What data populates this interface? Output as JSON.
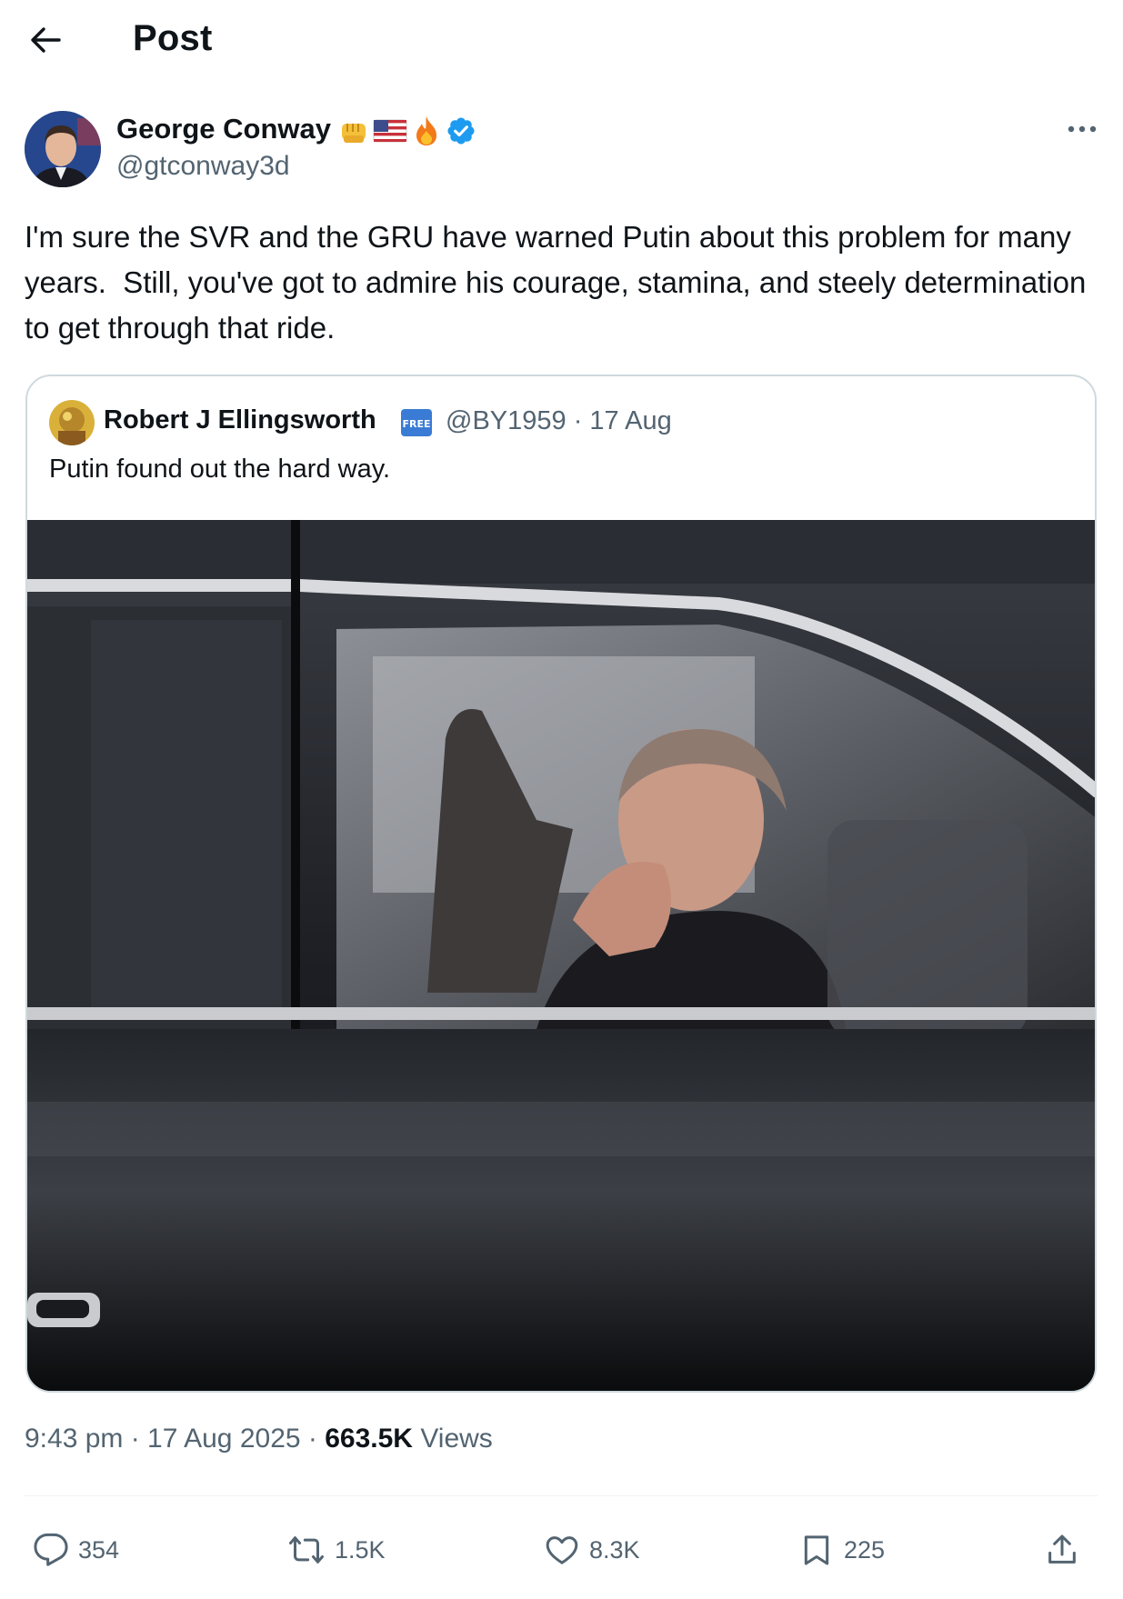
{
  "header": {
    "title": "Post"
  },
  "author": {
    "name": "George Conway",
    "handle": "@gtconway3d",
    "badges": [
      "fist-emoji",
      "us-flag-emoji",
      "fire-emoji",
      "verified-badge"
    ]
  },
  "post": {
    "text": "I'm sure the SVR and the GRU have warned Putin about this problem for many years.  Still, you've got to admire his courage, stamina, and steely determination to get through that ride."
  },
  "quote": {
    "name": "Robert J Ellingsworth",
    "badge": "FREE",
    "handle_date": "@BY1959 · 17 Aug",
    "text": "Putin found out the hard way."
  },
  "meta": {
    "time_date": "9:43 pm · 17 Aug 2025 · ",
    "views_count": "663.5K",
    "views_label": " Views"
  },
  "actions": {
    "replies": "354",
    "reposts": "1.5K",
    "likes": "8.3K",
    "bookmarks": "225"
  },
  "colors": {
    "text": "#0f1419",
    "secondary": "#536471",
    "verified": "#1d9bf0",
    "border": "#cfd9de"
  }
}
